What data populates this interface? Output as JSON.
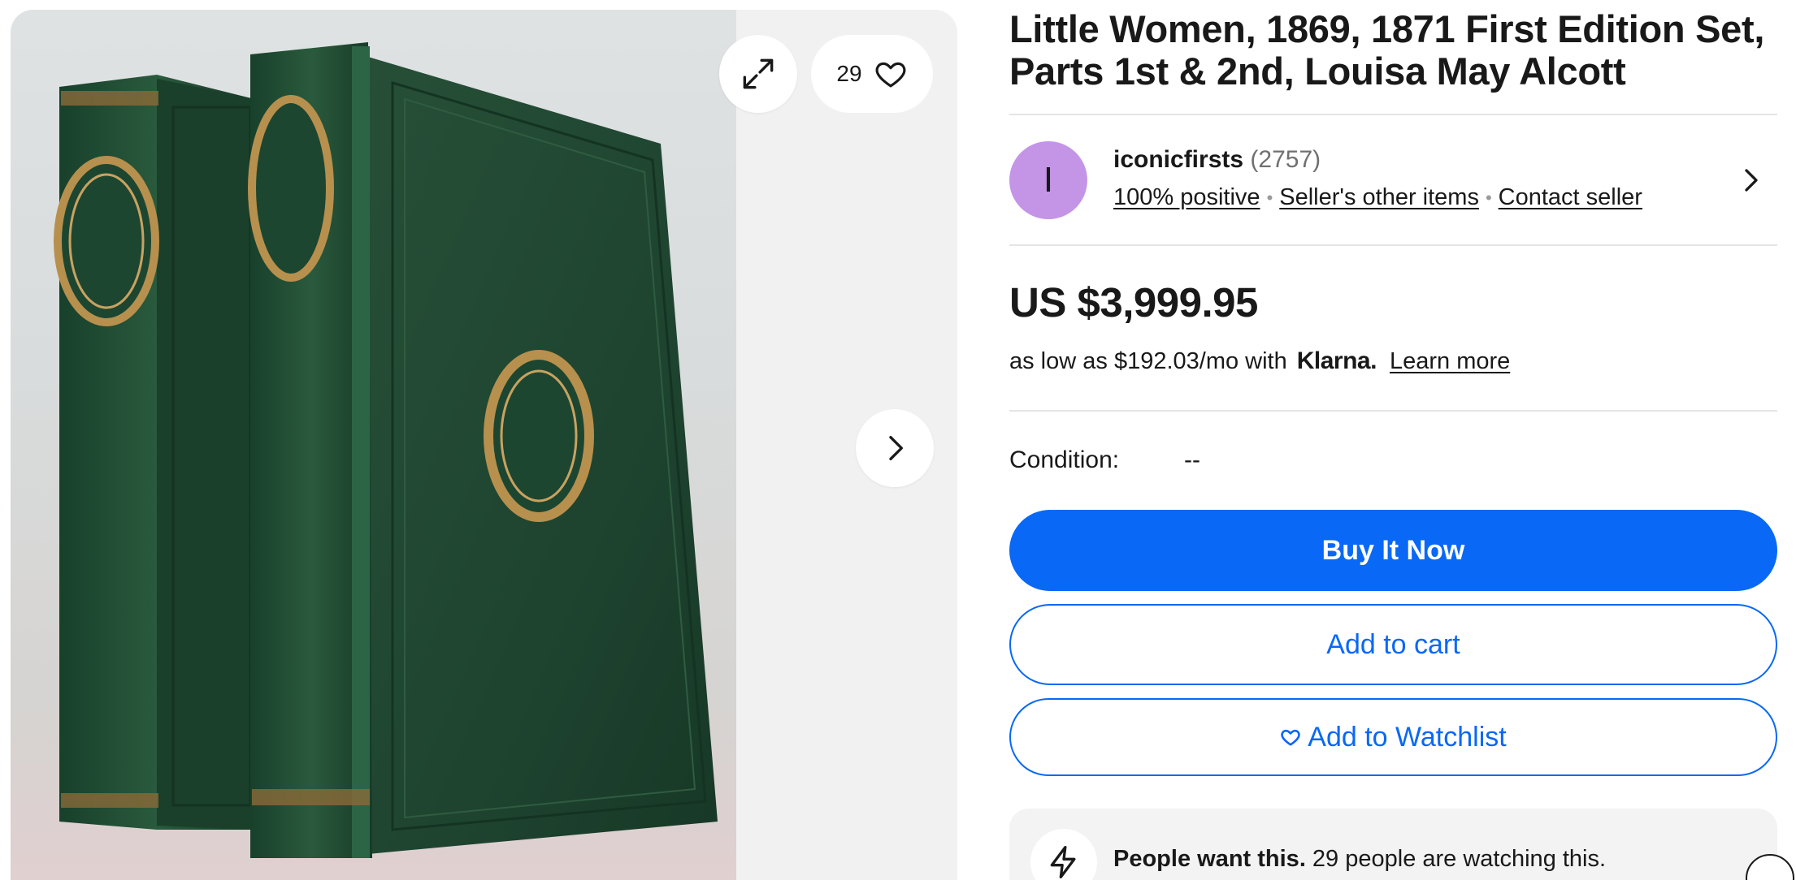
{
  "gallery": {
    "watchers_count": "29",
    "icons": {
      "expand": "expand-icon",
      "favorite": "heart-icon",
      "next": "chevron-right-icon"
    }
  },
  "listing": {
    "title": "Little Women, 1869, 1871 First Edition Set, Parts 1st & 2nd, Louisa May Alcott"
  },
  "seller": {
    "avatar_initial": "I",
    "name": "iconicfirsts",
    "feedback_count": "(2757)",
    "positive": "100% positive",
    "other_items": "Seller's other items",
    "contact": "Contact seller"
  },
  "price": {
    "amount": "US $3,999.95",
    "finance_text": "as low as $192.03/mo with",
    "klarna": "Klarna.",
    "learn_more": "Learn more"
  },
  "condition": {
    "label": "Condition:",
    "value": "--"
  },
  "actions": {
    "buy_now": "Buy It Now",
    "add_to_cart": "Add to cart",
    "add_to_watchlist": "Add to Watchlist"
  },
  "signal": {
    "bold": "People want this.",
    "text": " 29 people are watching this."
  },
  "colors": {
    "primary": "#0968f6",
    "avatar": "#c495e6",
    "text": "#191919",
    "panel": "#f1f1f1"
  }
}
